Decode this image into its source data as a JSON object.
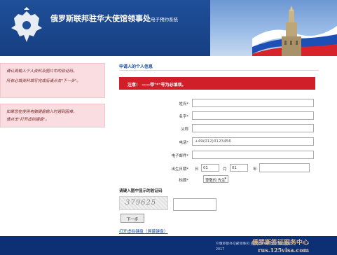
{
  "header": {
    "title": "俄罗斯联邦驻华大使馆领事处",
    "subtitle": "电子预约系统"
  },
  "left_panel": {
    "box1": {
      "line1": "请认真输入个人资料及图片中的验证码。",
      "line2": "所有必填资料填写完成后请点击\"下一步\"。"
    },
    "box2": {
      "line1": "如果您在使用电脑键盘输入时遇到困难，",
      "line2": "请点击\"打开虚拟键盘\"。"
    }
  },
  "form": {
    "section_title": "申请人的个人信息",
    "notice": "注意！ ——带\"*\"号为必填项。",
    "fields": {
      "surname_label": "姓氏*",
      "surname_value": "",
      "name_label": "名字*",
      "name_value": "",
      "patronymic_label": "父称",
      "patronymic_value": "",
      "phone_label": "电话*",
      "phone_value": "+49(012)0123456",
      "email_label": "电子邮件*",
      "email_value": "",
      "dob_label": "出生日期*",
      "dob_day_text": "日",
      "dob_day_value": "01",
      "dob_month_text": "月",
      "dob_month_value": "01",
      "dob_year_text": "年",
      "dob_year_value": "",
      "title_label": "标题*",
      "title_value": "尊敬的 先生"
    },
    "captcha_label": "请键入图中显示的验证码",
    "captcha_text": "379625",
    "next_button": "下一步",
    "keyboard_link": "打开虚拟键盘（屏幕键盘）"
  },
  "footer": {
    "copyright_line1": "©俄罗斯外交部领事司  驻外领事机构电子预约系统",
    "copyright_line2": "2017",
    "watermark_line1": "俄罗斯签证服务中心",
    "watermark_line2": "rus.125visa.com"
  },
  "colors": {
    "header_blue": "#1f4f98",
    "notice_red": "#d11f2a",
    "footer_navy": "#0d2f73",
    "info_pink": "#f9dde0"
  }
}
